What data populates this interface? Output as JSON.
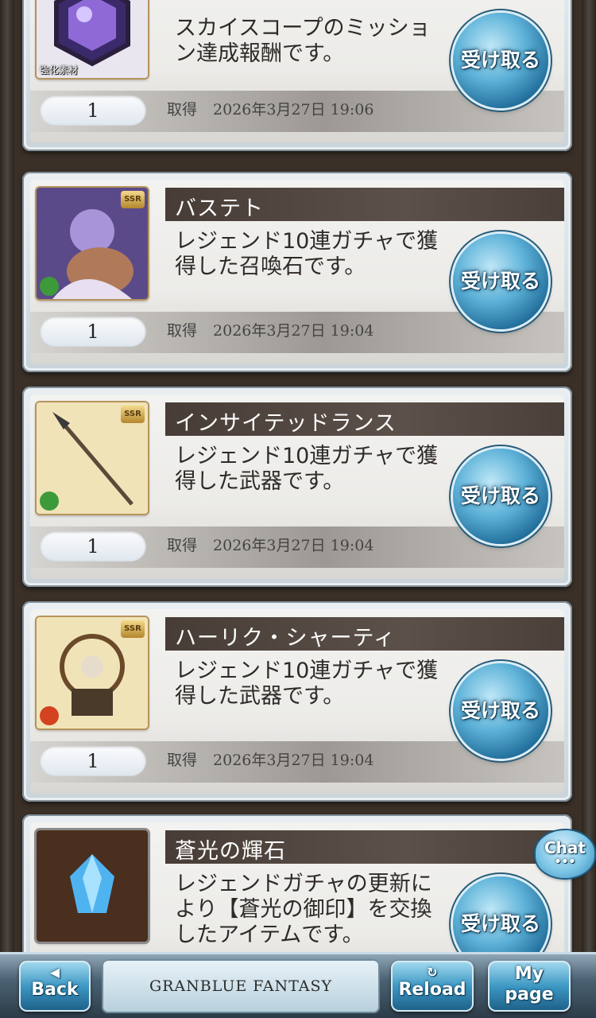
{
  "items": [
    {
      "title": "",
      "description_lines": [
        "スカイスコープのミッショ",
        "ン達成報酬です。"
      ],
      "quantity": "1",
      "obtained_label": "取得",
      "obtained_date": "2026年3月27日 19:06",
      "receive_label": "受け取る",
      "thumb_badge": "強化素材",
      "icon": "hexagon-crystal-material-icon"
    },
    {
      "title": "バステト",
      "description_lines": [
        "レジェンド10連ガチャで獲",
        "得した召喚石です。"
      ],
      "quantity": "1",
      "obtained_label": "取得",
      "obtained_date": "2026年3月27日 19:04",
      "receive_label": "受け取る",
      "rarity": "SSR",
      "icon": "bastet-summon-icon",
      "element_color": "#3d9a3a"
    },
    {
      "title": "インサイテッドランス",
      "description_lines": [
        "レジェンド10連ガチャで獲",
        "得した武器です。"
      ],
      "quantity": "1",
      "obtained_label": "取得",
      "obtained_date": "2026年3月27日 19:04",
      "receive_label": "受け取る",
      "rarity": "SSR",
      "icon": "spear-weapon-icon",
      "element_color": "#3d9a3a"
    },
    {
      "title": "ハーリク・シャーティ",
      "description_lines": [
        "レジェンド10連ガチャで獲",
        "得した武器です。"
      ],
      "quantity": "1",
      "obtained_label": "取得",
      "obtained_date": "2026年3月27日 19:04",
      "receive_label": "受け取る",
      "rarity": "SSR",
      "icon": "harp-weapon-icon",
      "element_color": "#d4431f"
    },
    {
      "title": "蒼光の輝石",
      "description_lines": [
        "レジェンドガチャの更新に",
        "より【蒼光の御印】を交換",
        "したアイテムです。"
      ],
      "receive_label": "受け取る",
      "icon": "blue-crystal-icon"
    }
  ],
  "chat": {
    "label": "Chat",
    "dots": "•••"
  },
  "footer": {
    "back_glyph": "◀",
    "back_label": "Back",
    "logo_text": "GRANBLUE FANTASY",
    "reload_glyph": "↻",
    "reload_label": "Reload",
    "mypage_line1": "My",
    "mypage_line2": "page"
  },
  "colors": {
    "accent_button": "#3d98c4",
    "title_bar": "#473c36"
  }
}
